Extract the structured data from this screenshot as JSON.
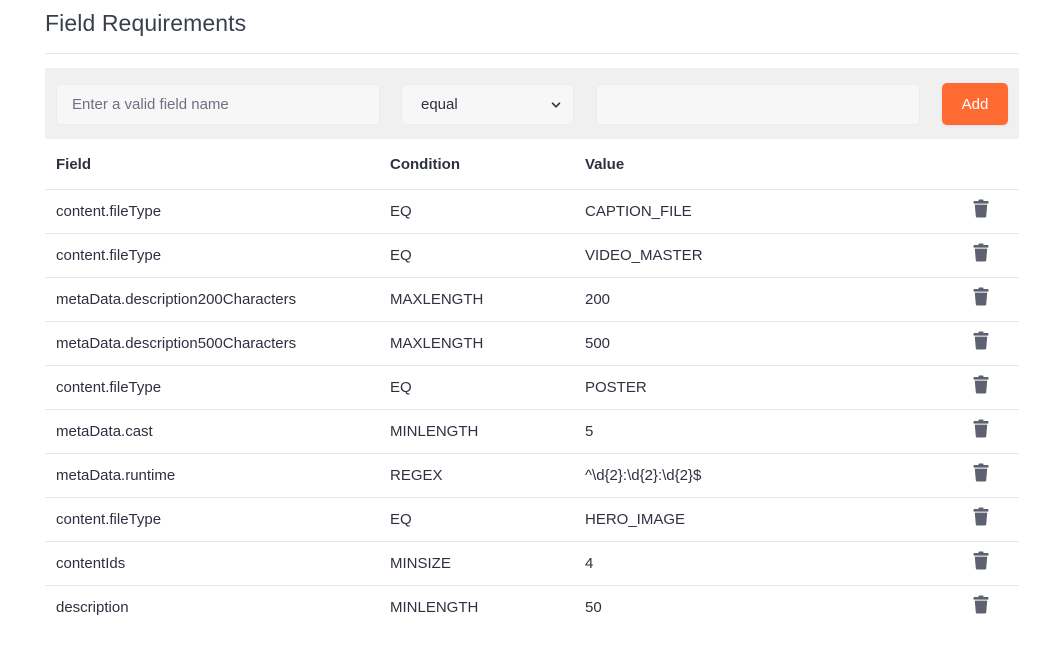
{
  "title": "Field Requirements",
  "filter": {
    "field_placeholder": "Enter a valid field name",
    "condition_selected": "equal",
    "value_text": "",
    "add_label": "Add"
  },
  "colors": {
    "accent": "#ff6a33",
    "icon": "#5d6170"
  },
  "table": {
    "headers": {
      "field": "Field",
      "condition": "Condition",
      "value": "Value"
    },
    "rows": [
      {
        "field": "content.fileType",
        "condition": "EQ",
        "value": "CAPTION_FILE"
      },
      {
        "field": "content.fileType",
        "condition": "EQ",
        "value": "VIDEO_MASTER"
      },
      {
        "field": "metaData.description200Characters",
        "condition": "MAXLENGTH",
        "value": "200"
      },
      {
        "field": "metaData.description500Characters",
        "condition": "MAXLENGTH",
        "value": "500"
      },
      {
        "field": "content.fileType",
        "condition": "EQ",
        "value": "POSTER"
      },
      {
        "field": "metaData.cast",
        "condition": "MINLENGTH",
        "value": "5"
      },
      {
        "field": "metaData.runtime",
        "condition": "REGEX",
        "value": "^\\d{2}:\\d{2}:\\d{2}$"
      },
      {
        "field": "content.fileType",
        "condition": "EQ",
        "value": "HERO_IMAGE"
      },
      {
        "field": "contentIds",
        "condition": "MINSIZE",
        "value": "4"
      },
      {
        "field": "description",
        "condition": "MINLENGTH",
        "value": "50"
      }
    ],
    "row_action_icon": "trash-icon"
  }
}
